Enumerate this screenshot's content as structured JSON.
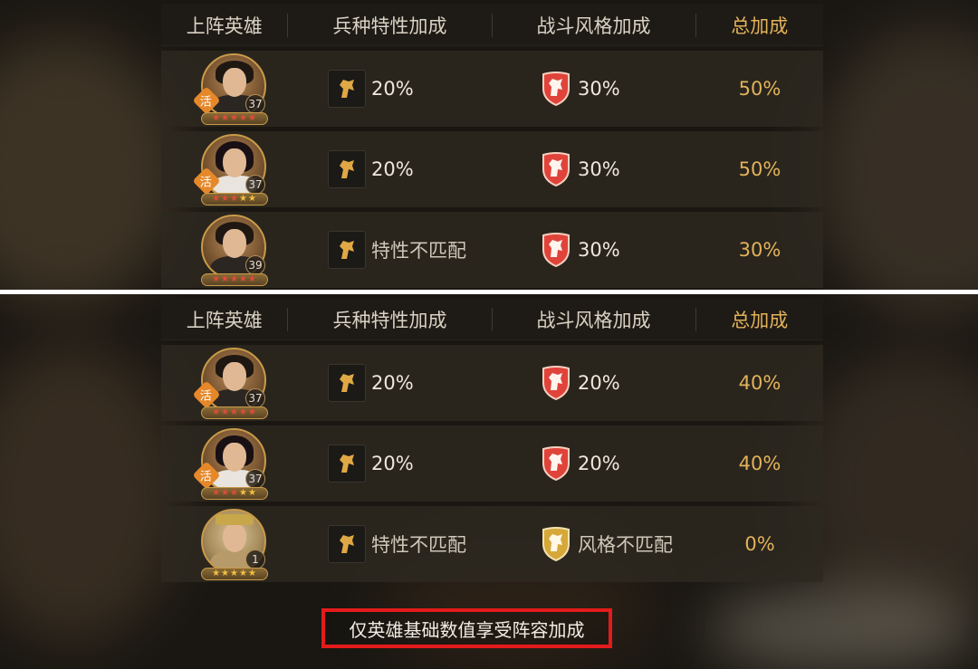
{
  "headers": {
    "hero": "上阵英雄",
    "trait_bonus": "兵种特性加成",
    "style_bonus": "战斗风格加成",
    "total_bonus": "总加成"
  },
  "colors": {
    "accent_gold": "#e2b25a",
    "shield_red": "#e0433a",
    "shield_gold": "#d6a83a",
    "caption_border": "#e41b1b"
  },
  "top_rows": [
    {
      "level": "37",
      "tag": "活",
      "stars": "★★★★★",
      "trait": "20%",
      "style": "30%",
      "style_icon": "red-lion-shield-icon",
      "total": "50%"
    },
    {
      "level": "37",
      "tag": "活",
      "stars": "★★★★★",
      "trait": "20%",
      "style": "30%",
      "style_icon": "red-lion-shield-icon",
      "total": "50%"
    },
    {
      "level": "39",
      "tag": "",
      "stars": "★★★★★",
      "trait": "特性不匹配",
      "style": "30%",
      "style_icon": "red-lion-shield-icon",
      "total": "30%"
    }
  ],
  "bottom_rows": [
    {
      "level": "37",
      "tag": "活",
      "stars": "★★★★★",
      "trait": "20%",
      "style": "20%",
      "style_icon": "red-lion-shield-icon",
      "total": "40%"
    },
    {
      "level": "37",
      "tag": "活",
      "stars": "★★★★★",
      "trait": "20%",
      "style": "20%",
      "style_icon": "red-lion-shield-icon",
      "total": "40%"
    },
    {
      "level": "1",
      "tag": "",
      "stars": "★★★★★",
      "trait": "特性不匹配",
      "style": "风格不匹配",
      "style_icon": "gold-lion-shield-icon",
      "total": "0%"
    }
  ],
  "caption": "仅英雄基础数值享受阵容加成"
}
